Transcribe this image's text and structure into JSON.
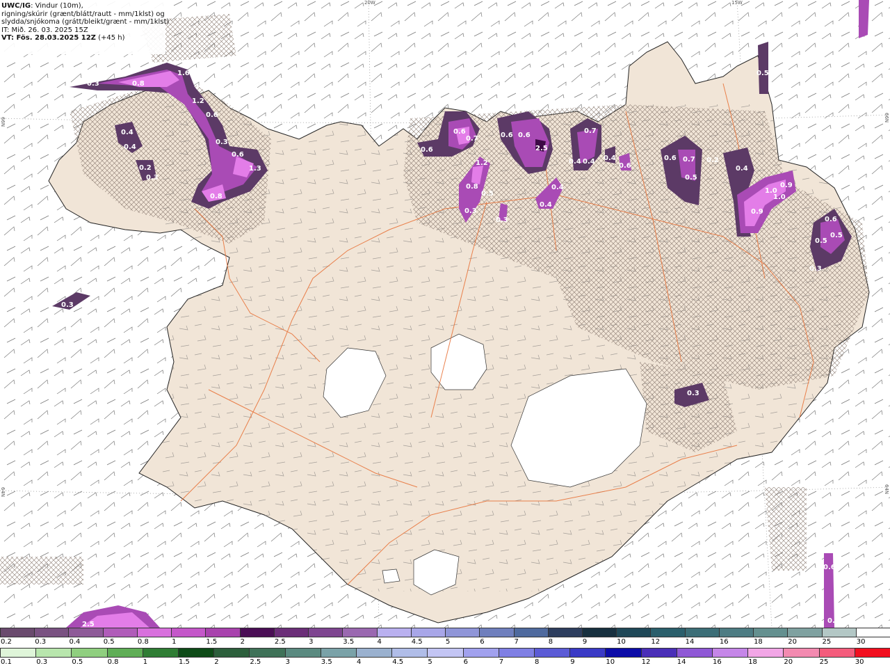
{
  "legend": {
    "title_bold": "UWC/IG",
    "title_rest": ": Vindur (10m),",
    "line2": "rigning/skúrir (grænt/blátt/rautt - mm/1klst) og",
    "line3": "slydda/snjókoma (grátt/bleikt/grænt - mm/1klst)",
    "it_line": "IT: Mið. 26. 03. 2025 15Z",
    "vt_bold": "VT: Fös. 28.03.2025 12Z",
    "vt_rest": " (+45 h)"
  },
  "axis_labels": {
    "lon_20w": "20W",
    "lon_15w": "15W",
    "lat_66n_left": "66N",
    "lat_66n_right": "66N",
    "lat_64n_left": "64N",
    "lat_64n_right": "64N"
  },
  "colors": {
    "land": "#f1e5d7",
    "sea": "#ffffff",
    "roads": "#e8743b",
    "glacier": "#ffffff",
    "precip_light": "#5c3a66",
    "precip_mid": "#a94bb5",
    "precip_high": "#e37de8",
    "precip_peak": "#3d0a45"
  },
  "precip_labels": [
    "0.3",
    "0.8",
    "1.6",
    "1.2",
    "0.6",
    "0.3",
    "0.6",
    "1.3",
    "0.8",
    "0.4",
    "0.4",
    "0.2",
    "0.3",
    "0.3",
    "0.6",
    "0.6",
    "0.7",
    "1.2",
    "0.8",
    "0.5",
    "0.3",
    "0.3",
    "0.6",
    "0.6",
    "2.5",
    "0.4",
    "0.4",
    "0.7",
    "0.4",
    "0.4",
    "0.4",
    "0.6",
    "0.6",
    "0.7",
    "0.2",
    "0.5",
    "0.4",
    "1.0",
    "0.9",
    "1.0",
    "0.9",
    "0.6",
    "0.5",
    "0.5",
    "0.3",
    "0.5",
    "0.3",
    "0.6",
    "0.4",
    "2.5"
  ],
  "snow_scale": {
    "labels": [
      "0.2",
      "0.3",
      "0.4",
      "0.5",
      "0.8",
      "1",
      "1.5",
      "2",
      "2.5",
      "3",
      "3.5",
      "4",
      "4.5",
      "5",
      "6",
      "7",
      "8",
      "9",
      "10",
      "12",
      "14",
      "16",
      "18",
      "20",
      "25",
      "30"
    ],
    "colors": [
      "#6a4a6e",
      "#7a5282",
      "#8e5a98",
      "#b05cb9",
      "#d870dd",
      "#c457c9",
      "#a842ad",
      "#4a0e55",
      "#6b2e78",
      "#7e4590",
      "#9a68b0",
      "#b9b0ef",
      "#a8a6e8",
      "#8f95d8",
      "#6f7fbd",
      "#4f6a9e",
      "#2d3e5e",
      "#17303f",
      "#1f4858",
      "#2a5f6c",
      "#3c6e77",
      "#4d7c83",
      "#64908f",
      "#7fa1a0",
      "#b3c7c5",
      "#ffffff"
    ]
  },
  "rain_scale": {
    "labels": [
      "0.1",
      "0.3",
      "0.5",
      "0.8",
      "1",
      "1.5",
      "2",
      "2.5",
      "3",
      "3.5",
      "4",
      "4.5",
      "5",
      "6",
      "7",
      "8",
      "9",
      "10",
      "12",
      "14",
      "16",
      "18",
      "20",
      "25",
      "30"
    ],
    "colors": [
      "#dff5d9",
      "#b8e6ad",
      "#8fcf7f",
      "#5fae56",
      "#2f7d34",
      "#0d4b17",
      "#2c5f3c",
      "#3f7258",
      "#5a8a80",
      "#7aa2a8",
      "#9ab1cf",
      "#b0bde8",
      "#c3c5f4",
      "#a1a1ee",
      "#7f7fe4",
      "#5b5bd6",
      "#3a3ac6",
      "#0c0ca8",
      "#4a2fb8",
      "#8f58d6",
      "#c586e8",
      "#f2a6e6",
      "#f38ab0",
      "#f45c7c",
      "#f20f1f"
    ]
  }
}
